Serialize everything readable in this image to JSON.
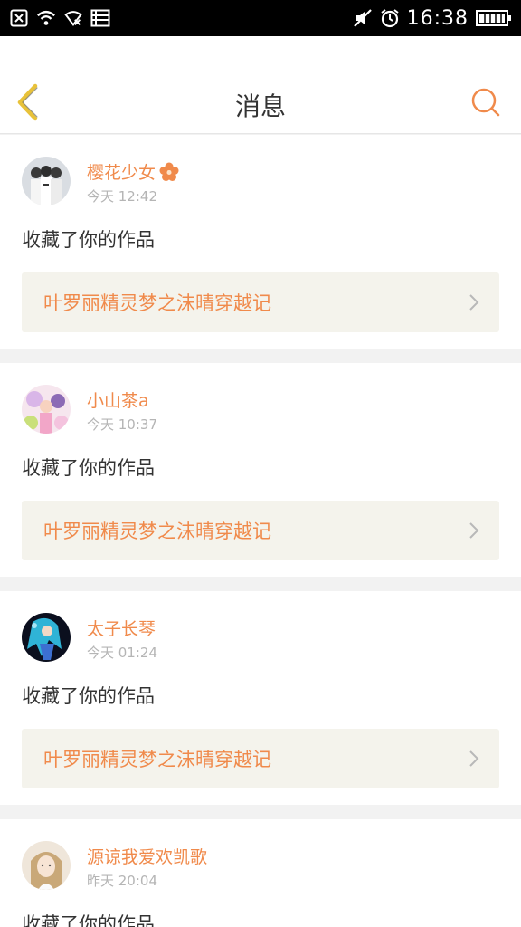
{
  "status_bar": {
    "time": "16:38",
    "icons_left": [
      "notification-close-icon",
      "wifi-icon",
      "signal-icon",
      "storage-icon"
    ],
    "icons_right": [
      "mute-icon",
      "alarm-icon",
      "battery-icon"
    ]
  },
  "header": {
    "title": "消息",
    "back_icon": "chevron-left-icon",
    "search_icon": "search-icon"
  },
  "colors": {
    "accent": "#f08a4b",
    "back_arrow": "#e8c23a",
    "card_link_bg": "#f4f3ec"
  },
  "messages": [
    {
      "username": "樱花少女",
      "badge_icon": "flower-icon",
      "time": "今天 12:42",
      "action": "收藏了你的作品",
      "work_title": "叶罗丽精灵梦之沫晴穿越记"
    },
    {
      "username": "小山茶a",
      "time": "今天 10:37",
      "action": "收藏了你的作品",
      "work_title": "叶罗丽精灵梦之沫晴穿越记"
    },
    {
      "username": "太子长琴",
      "time": "今天 01:24",
      "action": "收藏了你的作品",
      "work_title": "叶罗丽精灵梦之沫晴穿越记"
    },
    {
      "username": "源谅我爱欢凯歌",
      "time": "昨天 20:04",
      "action": "收藏了你的作品"
    }
  ]
}
